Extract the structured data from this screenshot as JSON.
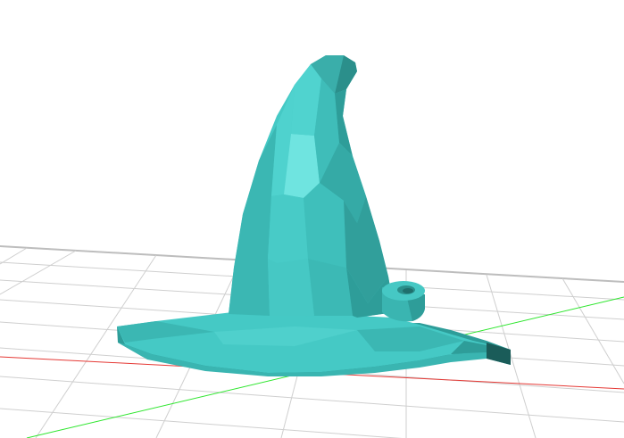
{
  "viewport": {
    "background": "#ffffff",
    "grid_color": "#cfcfcf",
    "grid_major_color": "#bdbdbd",
    "x_axis_color": "#e53935",
    "y_axis_color": "#2ee62e",
    "model_name": "wizard-hat",
    "model_colors": {
      "light": "#6fe4e0",
      "base": "#45c9c5",
      "mid": "#3bb7b3",
      "shade": "#2e9d99",
      "dark": "#237c78",
      "deep": "#17514e"
    }
  }
}
